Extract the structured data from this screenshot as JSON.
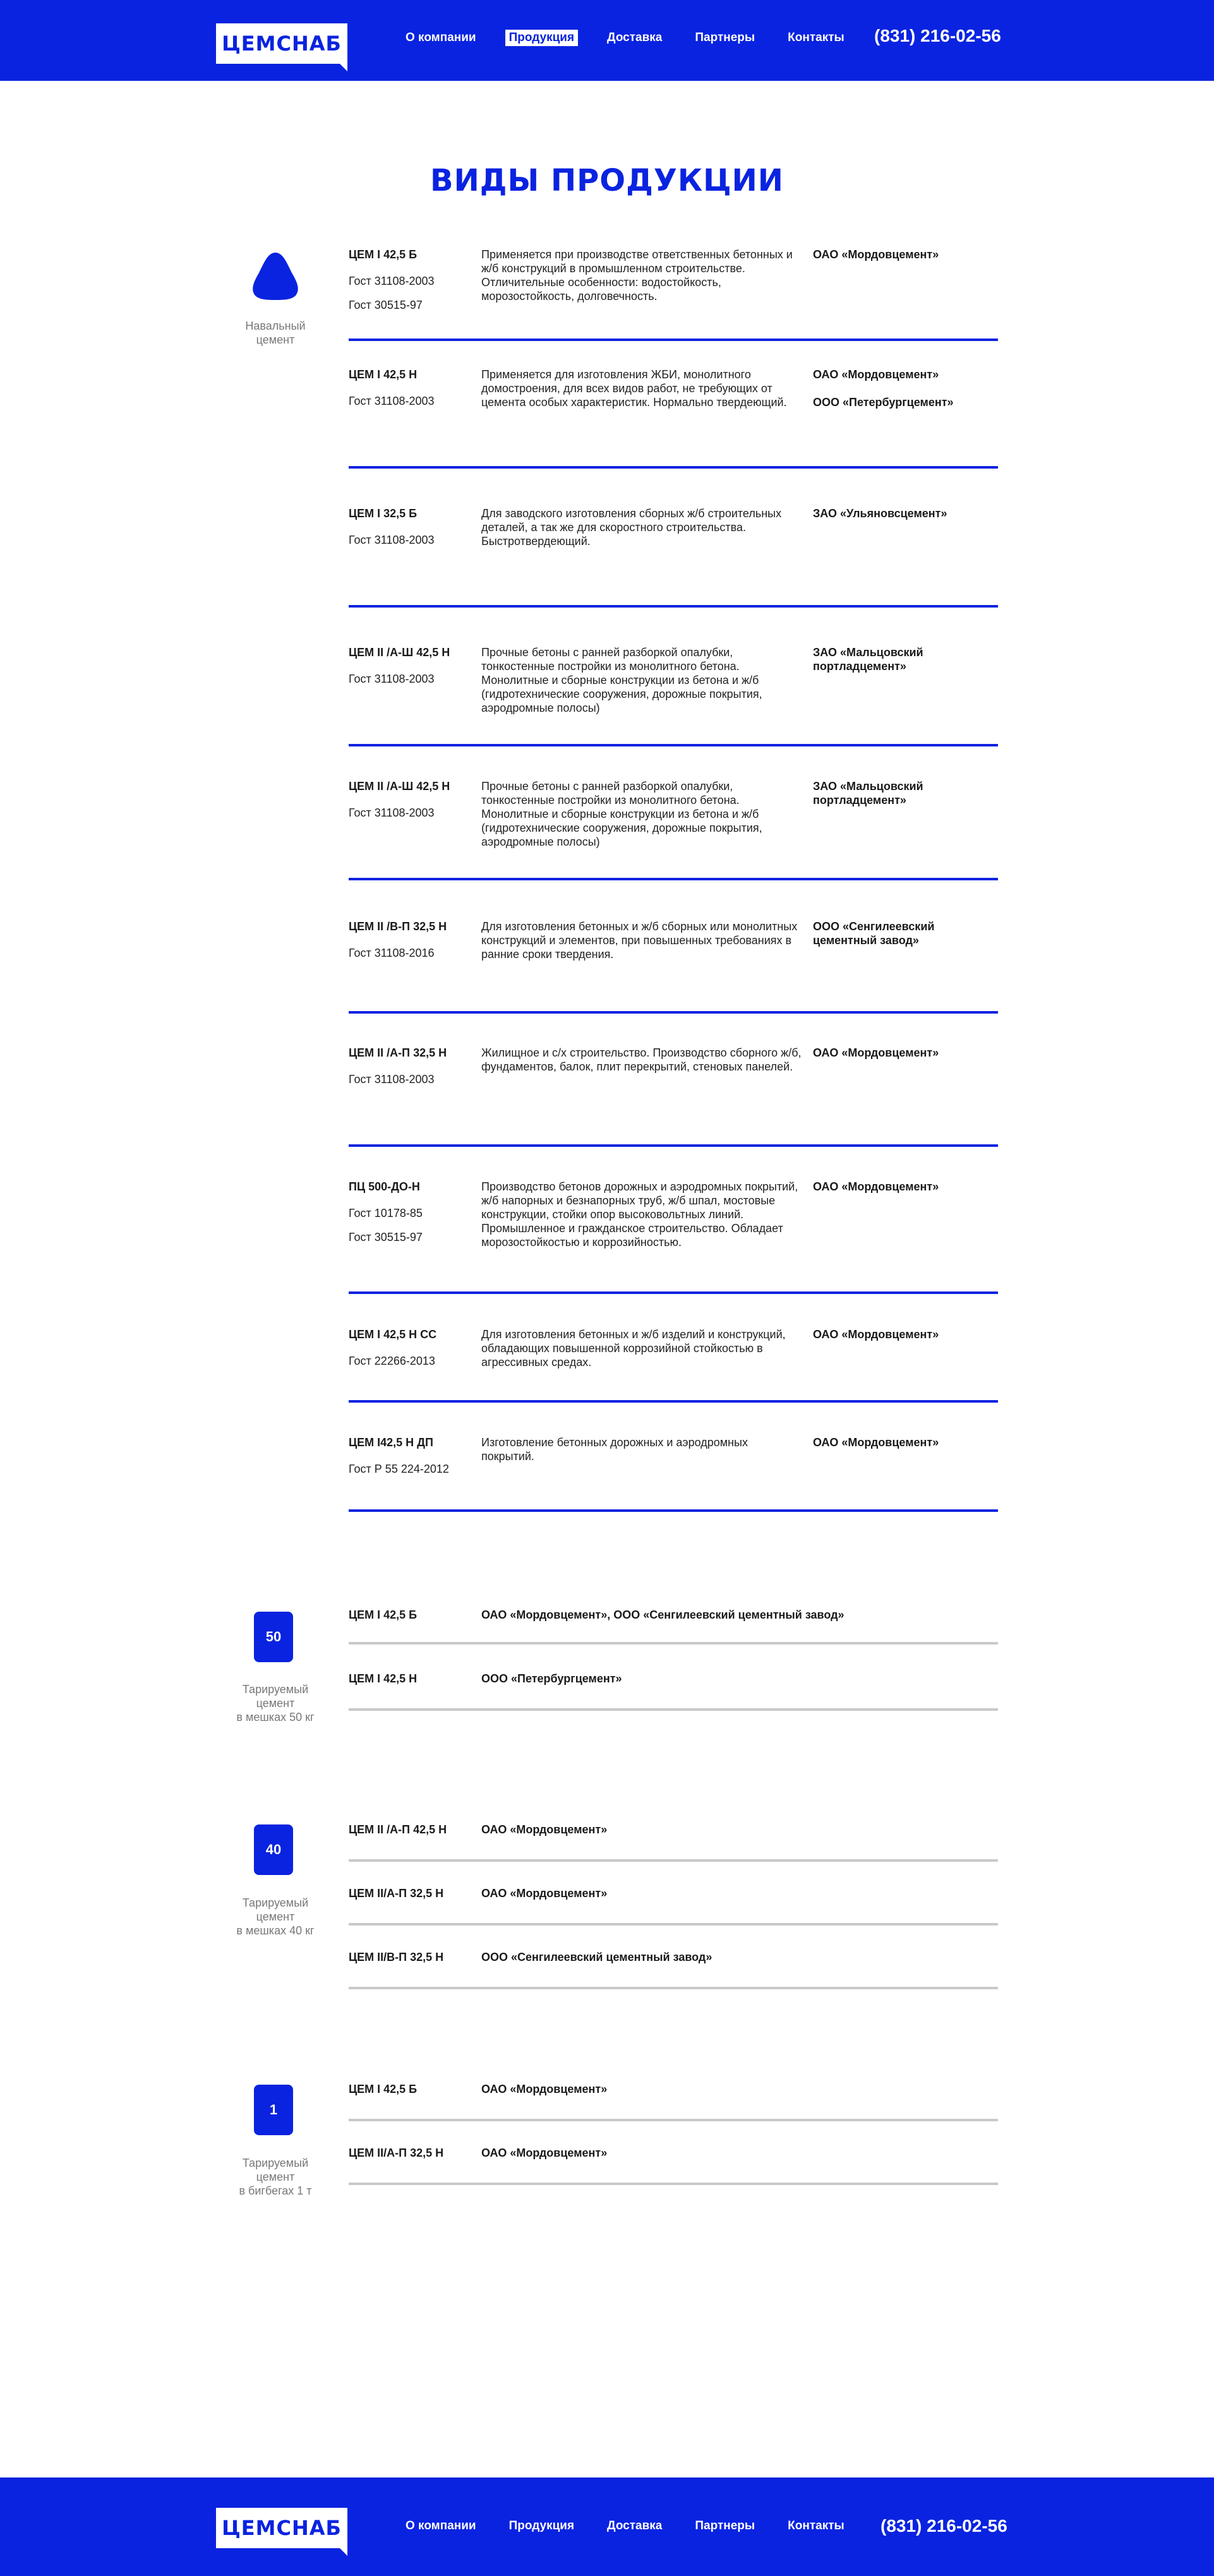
{
  "brand": {
    "logo_text": "ЦЕМСНАБ"
  },
  "nav": [
    {
      "label": "О компании",
      "active": false
    },
    {
      "label": "Продукция",
      "active": true
    },
    {
      "label": "Доставка",
      "active": false
    },
    {
      "label": "Партнеры",
      "active": false
    },
    {
      "label": "Контакты",
      "active": false
    }
  ],
  "phone": "(831) 216-02-56",
  "page_title": "ВИДЫ ПРОДУКЦИИ",
  "colors": {
    "accent": "#0a23e0",
    "divider": "#c9c9c9",
    "muted_text": "#777777"
  },
  "sections": {
    "bulk": {
      "icon": "drop-icon",
      "label": "Навальный\nцемент",
      "products": [
        {
          "name": "ЦЕМ I 42,5 Б",
          "gost": [
            "Гост 31108-2003",
            "Гост 30515-97"
          ],
          "description": "Применяется при производстве ответственных бетонных и ж/б конструкций в промышленном строительстве. Отличительные особенности: водостойкость, морозостойкость, долговечность.",
          "manufacturers": [
            "ОАО «Мордовцемент»"
          ]
        },
        {
          "name": "ЦЕМ I 42,5 Н",
          "gost": [
            "Гост 31108-2003"
          ],
          "description": "Применяется для изготовления ЖБИ, монолитного домостроения, для всех  видов работ, не требующих от цемента особых характеристик. Нормально твердеющий.",
          "manufacturers": [
            "ОАО «Мордовцемент»",
            "ООО «Петербургцемент»"
          ]
        },
        {
          "name": "ЦЕМ I 32,5 Б",
          "gost": [
            "Гост 31108-2003"
          ],
          "description": "Для заводского изготовления сборных ж/б строительных деталей, а так же для скоростного строительства. Быстротвердеющий.",
          "manufacturers": [
            "ЗАО «Ульяновсцемент»"
          ]
        },
        {
          "name": "ЦЕМ II /А-Ш 42,5 Н",
          "gost": [
            "Гост 31108-2003"
          ],
          "description": "Прочные бетоны с ранней разборкой опалубки, тонкостенные постройки из монолитного бетона. Монолитные и сборные конструкции из бетона и ж/б  (гидротехнические сооружения, дорожные покрытия, аэродромные полосы)",
          "manufacturers": [
            "ЗАО «Мальцовский портладцемент»"
          ]
        },
        {
          "name": "ЦЕМ II /А-Ш 42,5 Н",
          "gost": [
            "Гост 31108-2003"
          ],
          "description": "Прочные бетоны с ранней разборкой опалубки, тонкостенные постройки из монолитного бетона. Монолитные и сборные конструкции из бетона и ж/б  (гидротехнические сооружения, дорожные покрытия, аэродромные полосы)",
          "manufacturers": [
            "ЗАО «Мальцовский портладцемент»"
          ]
        },
        {
          "name": "ЦЕМ II /В-П 32,5 Н",
          "gost": [
            "Гост 31108-2016"
          ],
          "description": "Для изготовления бетонных и ж/б сборных или монолитных конструкций и элементов, при повышенных требованиях в ранние сроки твердения.",
          "manufacturers": [
            "ООО «Сенгилеевский цементный завод»"
          ]
        },
        {
          "name": "ЦЕМ II /А-П 32,5 Н",
          "gost": [
            "Гост 31108-2003"
          ],
          "description": "Жилищное и с/х строительство. Производство сборного ж/б, фундаментов, балок, плит перекрытий, стеновых панелей.",
          "manufacturers": [
            "ОАО «Мордовцемент»"
          ]
        },
        {
          "name": "ПЦ 500-ДО-Н",
          "gost": [
            "Гост 10178-85",
            "Гост 30515-97"
          ],
          "description": "Производство бетонов дорожных и аэродромных покрытий, ж/б напорных  и безнапорных труб, ж/б шпал, мостовые конструкции, стойки опор высоковольтных линий. Промышленное и гражданское строительство. Обладает морозостойкостью и коррозийностью.",
          "manufacturers": [
            "ОАО «Мордовцемент»"
          ]
        },
        {
          "name": "ЦЕМ I 42,5 Н СС",
          "gost": [
            "Гост 22266-2013"
          ],
          "description": "Для изготовления бетонных и ж/б изделий и конструкций, обладающих повышенной коррозийной стойкостью в агрессивных средах.",
          "manufacturers": [
            "ОАО «Мордовцемент»"
          ]
        },
        {
          "name": "ЦЕМ I42,5 Н ДП",
          "gost": [
            "Гост Р 55 224-2012"
          ],
          "description": "Изготовление бетонных дорожных и аэродромных покрытий.",
          "manufacturers": [
            "ОАО «Мордовцемент»"
          ]
        }
      ]
    },
    "bags50": {
      "badge": "50",
      "label": "Тарируемый\nцемент\nв мешках 50 кг",
      "products": [
        {
          "name": "ЦЕМ I 42,5 Б",
          "manufacturers": "ОАО «Мордовцемент», ООО «Сенгилеевский цементный завод»"
        },
        {
          "name": "ЦЕМ I 42,5 Н",
          "manufacturers": "ООО «Петербургцемент»"
        }
      ]
    },
    "bags40": {
      "badge": "40",
      "label": "Тарируемый\nцемент\nв мешках 40 кг",
      "products": [
        {
          "name": "ЦЕМ II /А-П 42,5 Н",
          "manufacturers": "ОАО «Мордовцемент»"
        },
        {
          "name": "ЦЕМ II/А-П 32,5 Н",
          "manufacturers": "ОАО «Мордовцемент»"
        },
        {
          "name": "ЦЕМ II/В-П 32,5 Н",
          "manufacturers": "ООО «Сенгилеевский цементный завод»"
        }
      ]
    },
    "bigbag": {
      "badge": "1",
      "label": "Тарируемый\nцемент\nв бигбегах 1 т",
      "products": [
        {
          "name": "ЦЕМ I 42,5 Б",
          "manufacturers": "ОАО «Мордовцемент»"
        },
        {
          "name": "ЦЕМ II/А-П 32,5 Н",
          "manufacturers": "ОАО «Мордовцемент»"
        }
      ]
    }
  }
}
